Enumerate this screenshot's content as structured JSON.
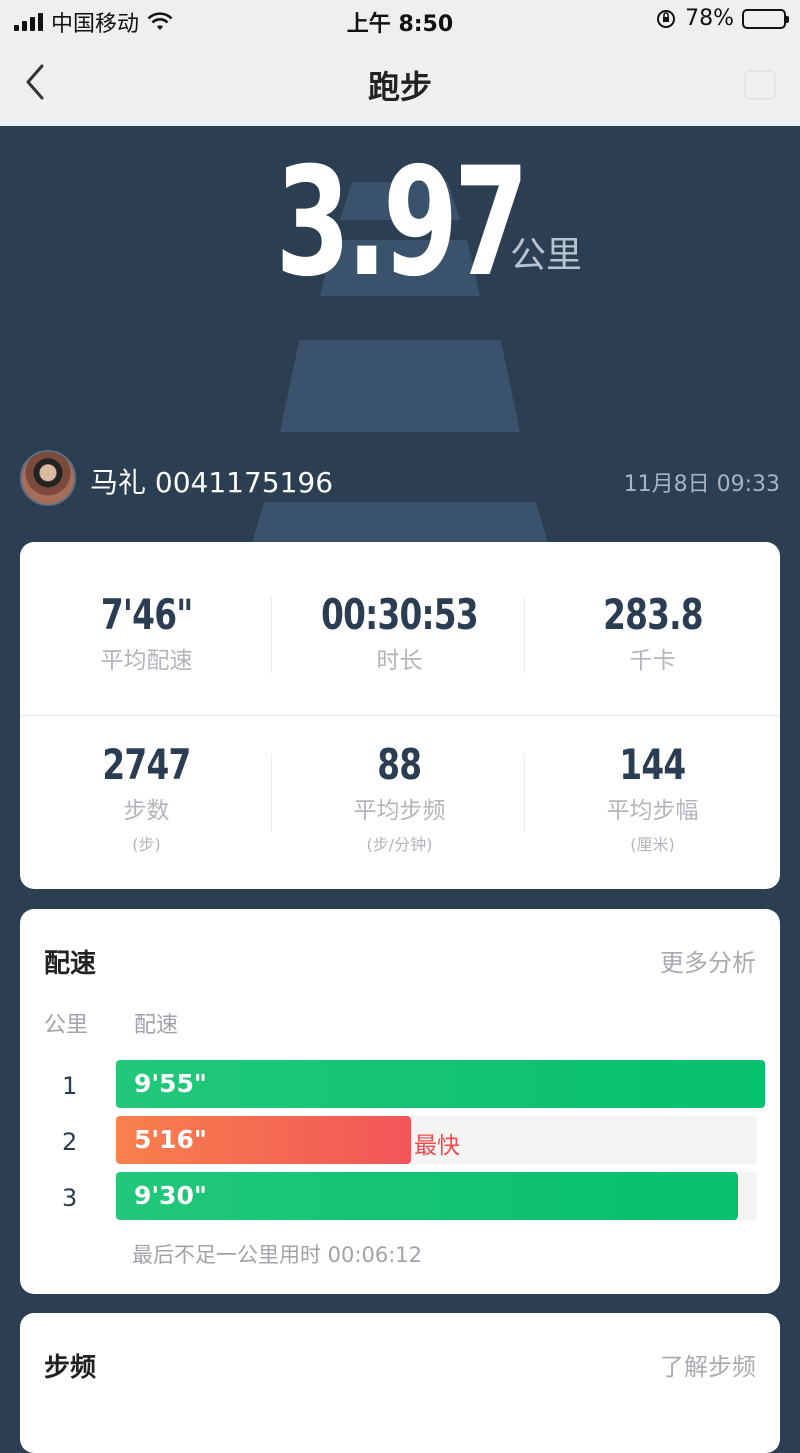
{
  "status": {
    "carrier": "中国移动",
    "time": "上午 8:50",
    "battery_percent": "78%",
    "battery_level": 0.78
  },
  "nav": {
    "title": "跑步"
  },
  "summary": {
    "distance": "3.97",
    "distance_unit": "公里"
  },
  "user": {
    "name": "马礼 0041175196",
    "datetime": "11月8日 09:33"
  },
  "stats": [
    {
      "value": "7'46\"",
      "label": "平均配速",
      "sub": ""
    },
    {
      "value": "00:30:53",
      "label": "时长",
      "sub": ""
    },
    {
      "value": "283.8",
      "label": "千卡",
      "sub": ""
    },
    {
      "value": "2747",
      "label": "步数",
      "sub": "(步)"
    },
    {
      "value": "88",
      "label": "平均步频",
      "sub": "(步/分钟)"
    },
    {
      "value": "144",
      "label": "平均步幅",
      "sub": "(厘米)"
    }
  ],
  "pace": {
    "title": "配速",
    "link": "更多分析",
    "col_km": "公里",
    "col_pace": "配速",
    "fastest_label": "最快",
    "note": "最后不足一公里用时 00:06:12",
    "rows": [
      {
        "km": "1",
        "pace": "9'55\"",
        "fill": 1.0,
        "color": "green"
      },
      {
        "km": "2",
        "pace": "5'16\"",
        "fill": 0.454,
        "color": "orange",
        "fastest": true
      },
      {
        "km": "3",
        "pace": "9'30\"",
        "fill": 0.958,
        "color": "green"
      }
    ]
  },
  "cadence": {
    "title": "步频",
    "link": "了解步频"
  },
  "colors": {
    "background": "#2b3e52",
    "green_start": "#22c77a",
    "green_end": "#05c06c",
    "orange_start": "#f9804c",
    "orange_end": "#f2555a",
    "fastest_text": "#f24c4c"
  }
}
